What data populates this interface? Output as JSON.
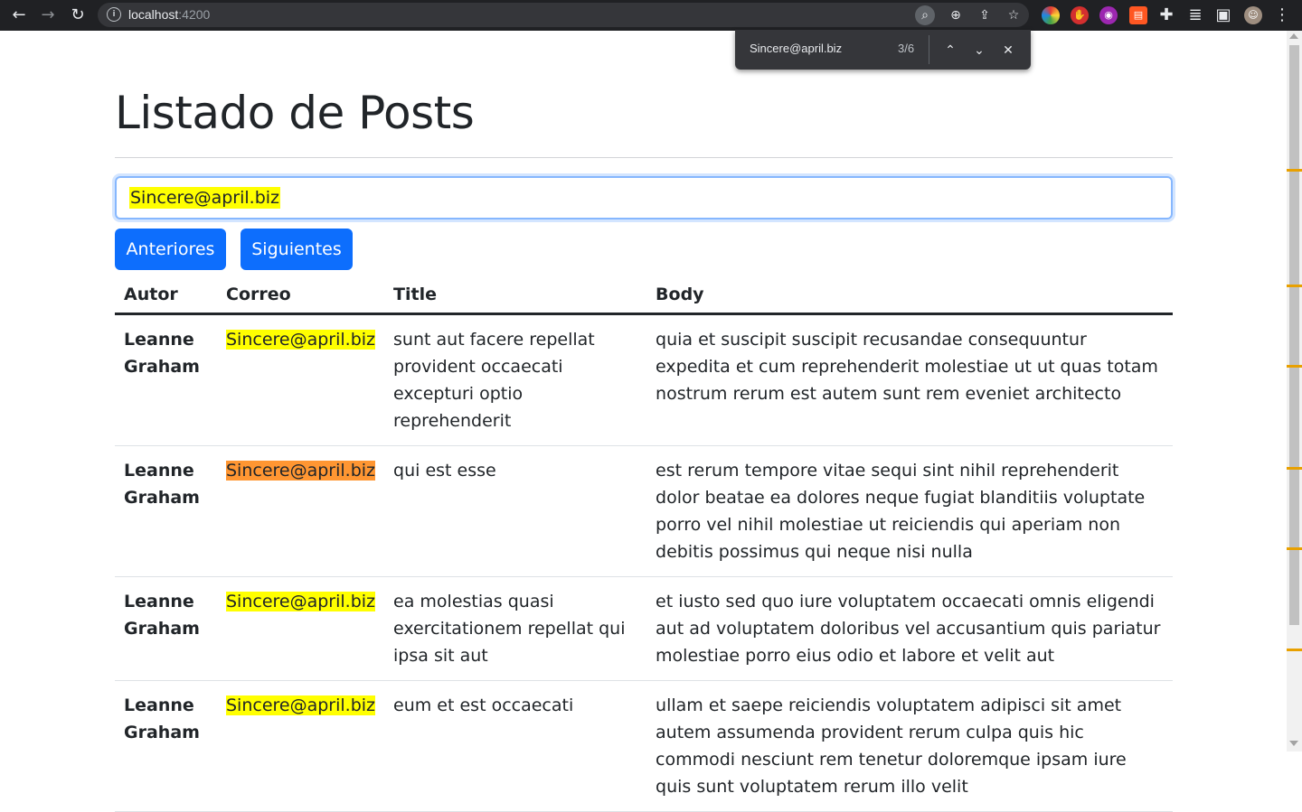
{
  "browser": {
    "url_host": "localhost",
    "url_port": ":4200",
    "find_query": "Sincere@april.biz",
    "find_count": "3/6"
  },
  "page": {
    "title": "Listado de Posts",
    "search_value": "Sincere@april.biz",
    "btn_prev": "Anteriores",
    "btn_next": "Siguientes"
  },
  "table": {
    "headers": [
      "Autor",
      "Correo",
      "Title",
      "Body"
    ],
    "rows": [
      {
        "author": "Leanne Graham",
        "email": "Sincere@april.biz",
        "title": "sunt aut facere repellat provident occaecati excepturi optio reprehenderit",
        "body": "quia et suscipit suscipit recusandae consequuntur expedita et cum reprehenderit molestiae ut ut quas totam nostrum rerum est autem sunt rem eveniet architecto"
      },
      {
        "author": "Leanne Graham",
        "email": "Sincere@april.biz",
        "title": "qui est esse",
        "body": "est rerum tempore vitae sequi sint nihil reprehenderit dolor beatae ea dolores neque fugiat blanditiis voluptate porro vel nihil molestiae ut reiciendis qui aperiam non debitis possimus qui neque nisi nulla"
      },
      {
        "author": "Leanne Graham",
        "email": "Sincere@april.biz",
        "title": "ea molestias quasi exercitationem repellat qui ipsa sit aut",
        "body": "et iusto sed quo iure voluptatem occaecati omnis eligendi aut ad voluptatem doloribus vel accusantium quis pariatur molestiae porro eius odio et labore et velit aut"
      },
      {
        "author": "Leanne Graham",
        "email": "Sincere@april.biz",
        "title": "eum et est occaecati",
        "body": "ullam et saepe reiciendis voluptatem adipisci sit amet autem assumenda provident rerum culpa quis hic commodi nesciunt rem tenetur doloremque ipsam iure quis sunt voluptatem rerum illo velit"
      }
    ]
  },
  "colors": {
    "find_highlight": "#ffff00",
    "find_current": "#ff9632",
    "button": "#0d6efd"
  }
}
